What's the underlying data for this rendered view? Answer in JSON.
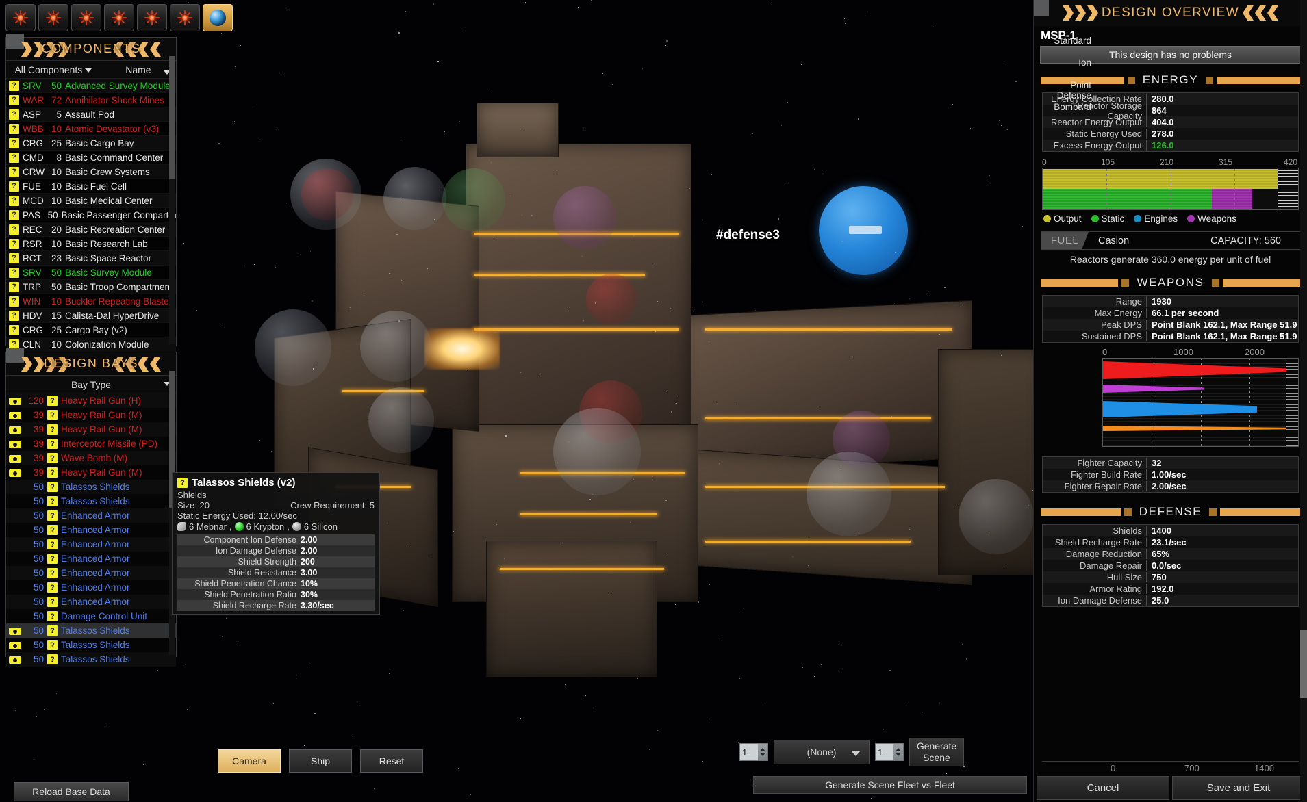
{
  "toolbar": {
    "buttons": [
      {
        "name": "empire-icon-1",
        "icon": "sun-icon"
      },
      {
        "name": "empire-icon-2",
        "icon": "sun-icon"
      },
      {
        "name": "empire-icon-3",
        "icon": "sun-icon"
      },
      {
        "name": "empire-icon-4",
        "icon": "sun-icon"
      },
      {
        "name": "empire-icon-5",
        "icon": "sun-icon"
      },
      {
        "name": "empire-icon-6",
        "icon": "sun-icon"
      },
      {
        "name": "planet-button",
        "icon": "globe-icon"
      }
    ]
  },
  "components_panel": {
    "title": "COMPONENTS",
    "filter_label": "All Components",
    "sort_label": "Name",
    "rows": [
      {
        "abbr": "SRV",
        "size": "50",
        "name": "Advanced Survey Module",
        "color": "green"
      },
      {
        "abbr": "WAR",
        "size": "72",
        "name": "Annihilator Shock Mines",
        "color": "red"
      },
      {
        "abbr": "ASP",
        "size": "5",
        "name": "Assault Pod",
        "color": "white"
      },
      {
        "abbr": "WBB",
        "size": "10",
        "name": "Atomic Devastator (v3)",
        "color": "red"
      },
      {
        "abbr": "CRG",
        "size": "25",
        "name": "Basic Cargo Bay",
        "color": "white"
      },
      {
        "abbr": "CMD",
        "size": "8",
        "name": "Basic Command Center",
        "color": "white"
      },
      {
        "abbr": "CRW",
        "size": "10",
        "name": "Basic Crew Systems",
        "color": "white"
      },
      {
        "abbr": "FUE",
        "size": "10",
        "name": "Basic Fuel Cell",
        "color": "white"
      },
      {
        "abbr": "MCD",
        "size": "10",
        "name": "Basic Medical Center",
        "color": "white"
      },
      {
        "abbr": "PAS",
        "size": "50",
        "name": "Basic Passenger Compartment",
        "color": "white"
      },
      {
        "abbr": "REC",
        "size": "20",
        "name": "Basic Recreation Center",
        "color": "white"
      },
      {
        "abbr": "RSR",
        "size": "10",
        "name": "Basic Research Lab",
        "color": "white"
      },
      {
        "abbr": "RCT",
        "size": "23",
        "name": "Basic Space Reactor",
        "color": "white"
      },
      {
        "abbr": "SRV",
        "size": "50",
        "name": "Basic Survey Module",
        "color": "green"
      },
      {
        "abbr": "TRP",
        "size": "50",
        "name": "Basic Troop Compartment",
        "color": "white"
      },
      {
        "abbr": "WIN",
        "size": "10",
        "name": "Buckler Repeating Blaster",
        "color": "red"
      },
      {
        "abbr": "HDV",
        "size": "15",
        "name": "Calista-Dal HyperDrive",
        "color": "white"
      },
      {
        "abbr": "CRG",
        "size": "25",
        "name": "Cargo Bay (v2)",
        "color": "white"
      },
      {
        "abbr": "CLN",
        "size": "10",
        "name": "Colonization Module",
        "color": "white"
      }
    ]
  },
  "design_bays_panel": {
    "title": "DESIGN BAYS",
    "column_header": "Bay Type",
    "rows": [
      {
        "camera": true,
        "size": "120",
        "name": "Heavy Rail Gun (H)",
        "color": "red",
        "selected": false
      },
      {
        "camera": true,
        "size": "39",
        "name": "Heavy Rail Gun (M)",
        "color": "red",
        "selected": false
      },
      {
        "camera": true,
        "size": "39",
        "name": "Heavy Rail Gun (M)",
        "color": "red",
        "selected": false
      },
      {
        "camera": true,
        "size": "39",
        "name": "Interceptor Missile (PD)",
        "color": "red",
        "selected": false
      },
      {
        "camera": true,
        "size": "39",
        "name": "Wave Bomb (M)",
        "color": "red",
        "selected": false
      },
      {
        "camera": true,
        "size": "39",
        "name": "Heavy Rail Gun (M)",
        "color": "red",
        "selected": false
      },
      {
        "camera": false,
        "size": "50",
        "name": "Talassos Shields",
        "color": "blue",
        "selected": false
      },
      {
        "camera": false,
        "size": "50",
        "name": "Talassos Shields",
        "color": "blue",
        "selected": false
      },
      {
        "camera": false,
        "size": "50",
        "name": "Enhanced Armor",
        "color": "blue",
        "selected": false
      },
      {
        "camera": false,
        "size": "50",
        "name": "Enhanced Armor",
        "color": "blue",
        "selected": false
      },
      {
        "camera": false,
        "size": "50",
        "name": "Enhanced Armor",
        "color": "blue",
        "selected": false
      },
      {
        "camera": false,
        "size": "50",
        "name": "Enhanced Armor",
        "color": "blue",
        "selected": false
      },
      {
        "camera": false,
        "size": "50",
        "name": "Enhanced Armor",
        "color": "blue",
        "selected": false
      },
      {
        "camera": false,
        "size": "50",
        "name": "Enhanced Armor",
        "color": "blue",
        "selected": false
      },
      {
        "camera": false,
        "size": "50",
        "name": "Enhanced Armor",
        "color": "blue",
        "selected": false
      },
      {
        "camera": false,
        "size": "50",
        "name": "Damage Control Unit",
        "color": "blue",
        "selected": false
      },
      {
        "camera": true,
        "size": "50",
        "name": "Talassos Shields",
        "color": "blue",
        "selected": true
      },
      {
        "camera": true,
        "size": "50",
        "name": "Talassos Shields",
        "color": "blue",
        "selected": false
      },
      {
        "camera": true,
        "size": "50",
        "name": "Talassos Shields",
        "color": "blue",
        "selected": false
      }
    ],
    "reload_button": "Reload Base Data"
  },
  "tooltip": {
    "title": "Talassos Shields (v2)",
    "category": "Shields",
    "size_label": "Size: 20",
    "crew_label": "Crew Requirement: 5",
    "energy_label": "Static Energy Used: 12.00/sec",
    "resources": [
      {
        "name": "6 Mebnar",
        "color": "#b0b0b0"
      },
      {
        "name": "6 Krypton",
        "color": "#2ad52a"
      },
      {
        "name": "6 Silicon",
        "color": "#c9c9c9"
      }
    ],
    "stats": [
      {
        "key": "Component Ion Defense",
        "value": "2.00"
      },
      {
        "key": "Ion Damage Defense",
        "value": "2.00"
      },
      {
        "key": "Shield Strength",
        "value": "200"
      },
      {
        "key": "Shield Resistance",
        "value": "3.00"
      },
      {
        "key": "Shield Penetration Chance",
        "value": "10%"
      },
      {
        "key": "Shield Penetration Ratio",
        "value": "30%"
      },
      {
        "key": "Shield Recharge Rate",
        "value": "3.30/sec"
      }
    ]
  },
  "viewport": {
    "ship_label": "#defense3",
    "view_buttons": [
      {
        "label": "Camera",
        "active": true
      },
      {
        "label": "Ship",
        "active": false
      },
      {
        "label": "Reset",
        "active": false
      }
    ],
    "scene": {
      "left_count": "1",
      "combo_value": "(None)",
      "right_count": "1",
      "generate_button": "Generate Scene",
      "fleet_button": "Generate Scene Fleet vs Fleet"
    }
  },
  "overview": {
    "title": "DESIGN OVERVIEW",
    "design_name": "MSP-1",
    "status": "This design has no problems",
    "energy": {
      "header": "ENERGY",
      "stats": [
        {
          "key": "Energy Collection Rate",
          "value": "280.0",
          "green": false
        },
        {
          "key": "Reactor Storage Capacity",
          "value": "864",
          "green": false
        },
        {
          "key": "Reactor Energy Output",
          "value": "404.0",
          "green": false
        },
        {
          "key": "Static Energy Used",
          "value": "278.0",
          "green": false
        },
        {
          "key": "Excess Energy Output",
          "value": "126.0",
          "green": true
        }
      ]
    },
    "fuel": {
      "tag": "FUEL",
      "name": "Caslon",
      "capacity": "CAPACITY: 560",
      "note": "Reactors generate 360.0 energy per unit of fuel"
    },
    "weapons": {
      "header": "WEAPONS",
      "stats": [
        {
          "key": "Range",
          "value": "1930"
        },
        {
          "key": "Max Energy",
          "value": "66.1 per second"
        },
        {
          "key": "Peak DPS",
          "value": "Point Blank 162.1, Max Range 51.9"
        },
        {
          "key": "Sustained DPS",
          "value": "Point Blank 162.1, Max Range 51.9"
        }
      ],
      "fighter_stats": [
        {
          "key": "Fighter Capacity",
          "value": "32"
        },
        {
          "key": "Fighter Build Rate",
          "value": "1.00/sec"
        },
        {
          "key": "Fighter Repair Rate",
          "value": "2.00/sec"
        }
      ]
    },
    "defense": {
      "header": "DEFENSE",
      "stats": [
        {
          "key": "Shields",
          "value": "1400"
        },
        {
          "key": "Shield Recharge Rate",
          "value": "23.1/sec"
        },
        {
          "key": "Damage Reduction",
          "value": "65%"
        },
        {
          "key": "Damage Repair",
          "value": "0.0/sec"
        },
        {
          "key": "Hull Size",
          "value": "750"
        },
        {
          "key": "Armor Rating",
          "value": "192.0"
        },
        {
          "key": "Ion Damage Defense",
          "value": "25.0"
        }
      ],
      "axis_ticks": [
        "0",
        "700",
        "1400"
      ]
    },
    "buttons": {
      "cancel": "Cancel",
      "save": "Save and Exit"
    }
  },
  "chart_data": [
    {
      "type": "bar",
      "title": "ENERGY",
      "orientation": "horizontal-stacked",
      "xlabel": "",
      "ylabel": "",
      "xlim": [
        0,
        420
      ],
      "xticks": [
        0,
        105,
        210,
        315,
        420
      ],
      "tick_labels": [
        "0",
        "105",
        "210",
        "315",
        "420"
      ],
      "legend": [
        "Output",
        "Static",
        "Engines",
        "Weapons"
      ],
      "legend_colors": [
        "#c9c02e",
        "#2fbb2f",
        "#1790c4",
        "#a435b0"
      ],
      "legend_position": "below",
      "series": [
        {
          "name": "Output",
          "values": [
            404.0
          ],
          "color": "#c9c02e"
        },
        {
          "name": "Static",
          "values": [
            278.0
          ],
          "color": "#2fbb2f"
        },
        {
          "name": "Engines",
          "values": [
            0.0
          ],
          "color": "#1790c4"
        },
        {
          "name": "Weapons",
          "values": [
            66.1
          ],
          "color": "#a435b0"
        }
      ]
    },
    {
      "type": "area",
      "title": "WEAPONS damage by range",
      "xlabel": "",
      "ylabel": "",
      "xlim": [
        0,
        2200
      ],
      "xticks": [
        0,
        1000,
        2000
      ],
      "tick_labels": [
        "0",
        "1000",
        "2000"
      ],
      "categories": [
        "Standard",
        "Ion",
        "Point Defense",
        "Bombard"
      ],
      "series": [
        {
          "name": "Standard",
          "range": 1930,
          "peak": 162.1,
          "falloff": 51.9,
          "color": "#ee1c1c"
        },
        {
          "name": "Ion",
          "range": 1100,
          "peak": 40,
          "falloff": 18,
          "color": "#c13ed6"
        },
        {
          "name": "Point Defense",
          "range": 1700,
          "peak": 120,
          "falloff": 45,
          "color": "#1f8fe6"
        },
        {
          "name": "Bombard",
          "range": 1930,
          "peak": 18,
          "falloff": 12,
          "color": "#f28c1c"
        }
      ]
    },
    {
      "type": "area",
      "title": "DEFENSE by range",
      "xlim": [
        0,
        1400
      ],
      "xticks": [
        0,
        700,
        1400
      ],
      "tick_labels": [
        "0",
        "700",
        "1400"
      ],
      "series": []
    }
  ]
}
